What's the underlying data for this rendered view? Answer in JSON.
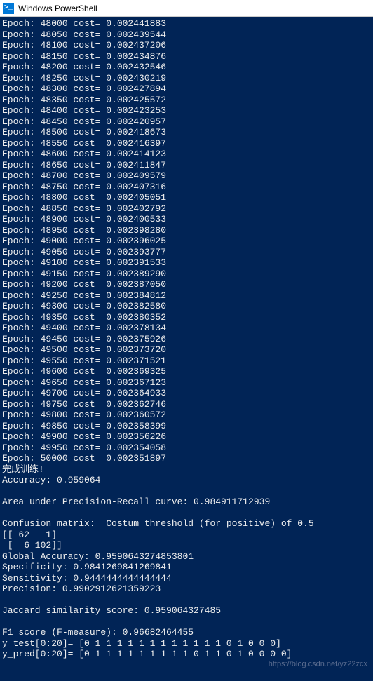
{
  "window": {
    "title": "Windows PowerShell",
    "icon_label": ">_"
  },
  "epochs": [
    {
      "epoch": "48000",
      "cost": "0.002441883"
    },
    {
      "epoch": "48050",
      "cost": "0.002439544"
    },
    {
      "epoch": "48100",
      "cost": "0.002437206"
    },
    {
      "epoch": "48150",
      "cost": "0.002434876"
    },
    {
      "epoch": "48200",
      "cost": "0.002432546"
    },
    {
      "epoch": "48250",
      "cost": "0.002430219"
    },
    {
      "epoch": "48300",
      "cost": "0.002427894"
    },
    {
      "epoch": "48350",
      "cost": "0.002425572"
    },
    {
      "epoch": "48400",
      "cost": "0.002423253"
    },
    {
      "epoch": "48450",
      "cost": "0.002420957"
    },
    {
      "epoch": "48500",
      "cost": "0.002418673"
    },
    {
      "epoch": "48550",
      "cost": "0.002416397"
    },
    {
      "epoch": "48600",
      "cost": "0.002414123"
    },
    {
      "epoch": "48650",
      "cost": "0.002411847"
    },
    {
      "epoch": "48700",
      "cost": "0.002409579"
    },
    {
      "epoch": "48750",
      "cost": "0.002407316"
    },
    {
      "epoch": "48800",
      "cost": "0.002405051"
    },
    {
      "epoch": "48850",
      "cost": "0.002402792"
    },
    {
      "epoch": "48900",
      "cost": "0.002400533"
    },
    {
      "epoch": "48950",
      "cost": "0.002398280"
    },
    {
      "epoch": "49000",
      "cost": "0.002396025"
    },
    {
      "epoch": "49050",
      "cost": "0.002393777"
    },
    {
      "epoch": "49100",
      "cost": "0.002391533"
    },
    {
      "epoch": "49150",
      "cost": "0.002389290"
    },
    {
      "epoch": "49200",
      "cost": "0.002387050"
    },
    {
      "epoch": "49250",
      "cost": "0.002384812"
    },
    {
      "epoch": "49300",
      "cost": "0.002382580"
    },
    {
      "epoch": "49350",
      "cost": "0.002380352"
    },
    {
      "epoch": "49400",
      "cost": "0.002378134"
    },
    {
      "epoch": "49450",
      "cost": "0.002375926"
    },
    {
      "epoch": "49500",
      "cost": "0.002373720"
    },
    {
      "epoch": "49550",
      "cost": "0.002371521"
    },
    {
      "epoch": "49600",
      "cost": "0.002369325"
    },
    {
      "epoch": "49650",
      "cost": "0.002367123"
    },
    {
      "epoch": "49700",
      "cost": "0.002364933"
    },
    {
      "epoch": "49750",
      "cost": "0.002362746"
    },
    {
      "epoch": "49800",
      "cost": "0.002360572"
    },
    {
      "epoch": "49850",
      "cost": "0.002358399"
    },
    {
      "epoch": "49900",
      "cost": "0.002356226"
    },
    {
      "epoch": "49950",
      "cost": "0.002354058"
    },
    {
      "epoch": "50000",
      "cost": "0.002351897"
    }
  ],
  "training_done": "完成训练!",
  "accuracy_line": "Accuracy: 0.959064",
  "blank": "",
  "auprc_line": "Area under Precision-Recall curve: 0.984911712939",
  "cm_header": "Confusion matrix:  Costum threshold (for positive) of 0.5",
  "cm_row1": "[[ 62   1]",
  "cm_row2": " [  6 102]]",
  "global_accuracy": "Global Accuracy: 0.9590643274853801",
  "specificity": "Specificity: 0.9841269841269841",
  "sensitivity": "Sensitivity: 0.9444444444444444",
  "precision": "Precision: 0.9902912621359223",
  "jaccard": "Jaccard similarity score: 0.959064327485",
  "f1": "F1 score (F-measure): 0.96682464455",
  "y_test": "y_test[0:20]= [0 1 1 1 1 1 1 1 1 1 1 1 1 0 1 0 0 0]",
  "y_pred": "y_pred[0:20]= [0 1 1 1 1 1 1 1 1 1 0 1 1 0 1 0 0 0 0]",
  "watermark": "https://blog.csdn.net/yz22zcx"
}
